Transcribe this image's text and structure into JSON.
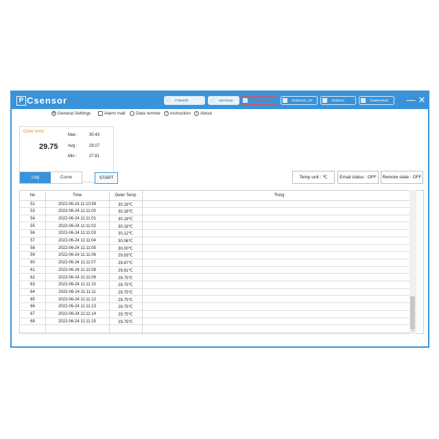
{
  "app": {
    "logo_box": "P",
    "logo_text": "Csensor"
  },
  "titlebar": {
    "minimize": "—",
    "close": "✕"
  },
  "devices": [
    {
      "label": "PT8640ht",
      "style": "white"
    },
    {
      "label": "SDGTemp",
      "style": "white"
    },
    {
      "label": "TEMPerHUM",
      "style": "active"
    },
    {
      "label": "TEMPer1F_TR",
      "style": "normal"
    },
    {
      "label": "TEMPer2",
      "style": "normal"
    },
    {
      "label": "TEMPerHUM",
      "style": "normal"
    }
  ],
  "menu": [
    {
      "label": "General Settings",
      "icon": "gear-icon"
    },
    {
      "label": "Alarm mail",
      "icon": "mail-icon"
    },
    {
      "label": "Data remote",
      "icon": "link-icon"
    },
    {
      "label": "Instruction",
      "icon": "help-icon"
    },
    {
      "label": "About",
      "icon": "info-icon"
    }
  ],
  "stats": {
    "title": "Outer temp",
    "current": "29.75",
    "max_label": "Max :",
    "max": "30.43",
    "avg_label": "Avg :",
    "avg": "29.07",
    "min_label": "Min :",
    "min": "27.81"
  },
  "tabs": [
    {
      "label": "Log"
    },
    {
      "label": "Curve"
    }
  ],
  "buttons": {
    "start": "START",
    "temp_unit": "Temp unit : ℃",
    "email_status": "Email status : OFF",
    "remote_state": "Remote state : OFF"
  },
  "table": {
    "columns": [
      "No",
      "Time",
      "Outer Temp",
      "Thing"
    ],
    "rows": [
      [
        "52",
        "2022-06-24 11:10:59",
        "30.18℃",
        ""
      ],
      [
        "53",
        "2022-06-24 11:11:00",
        "30.18℃",
        ""
      ],
      [
        "54",
        "2022-06-24 11:11:01",
        "30.18℃",
        ""
      ],
      [
        "55",
        "2022-06-24 11:11:02",
        "30.18℃",
        ""
      ],
      [
        "56",
        "2022-06-24 11:11:03",
        "30.12℃",
        ""
      ],
      [
        "57",
        "2022-06-24 11:11:04",
        "30.06℃",
        ""
      ],
      [
        "58",
        "2022-06-24 11:11:05",
        "30.00℃",
        ""
      ],
      [
        "59",
        "2022-06-24 11:11:06",
        "29.93℃",
        ""
      ],
      [
        "60",
        "2022-06-24 11:11:07",
        "29.87℃",
        ""
      ],
      [
        "61",
        "2022-06-24 11:11:08",
        "29.81℃",
        ""
      ],
      [
        "62",
        "2022-06-24 11:11:09",
        "29.75℃",
        ""
      ],
      [
        "63",
        "2022-06-24 11:11:10",
        "29.75℃",
        ""
      ],
      [
        "64",
        "2022-06-24 11:11:11",
        "29.75℃",
        ""
      ],
      [
        "65",
        "2022-06-24 11:11:12",
        "29.75℃",
        ""
      ],
      [
        "66",
        "2022-06-24 11:11:13",
        "29.75℃",
        ""
      ],
      [
        "67",
        "2022-06-24 11:11:14",
        "29.75℃",
        ""
      ],
      [
        "68",
        "2022-06-24 11:11:15",
        "29.75℃",
        ""
      ]
    ]
  }
}
